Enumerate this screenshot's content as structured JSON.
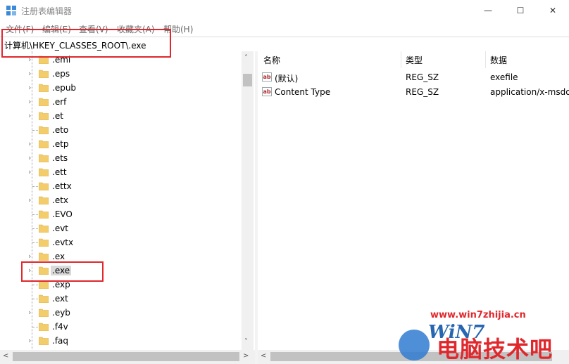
{
  "window": {
    "title": "注册表编辑器",
    "minimize_glyph": "—",
    "maximize_glyph": "☐",
    "close_glyph": "✕"
  },
  "menu": [
    "文件(F)",
    "编辑(E)",
    "查看(V)",
    "收藏夹(A)",
    "帮助(H)"
  ],
  "address": {
    "path": "计算机\\HKEY_CLASSES_ROOT\\.exe"
  },
  "tree": {
    "items": [
      {
        "label": ".eml",
        "expandable": true
      },
      {
        "label": ".eps",
        "expandable": true
      },
      {
        "label": ".epub",
        "expandable": true
      },
      {
        "label": ".erf",
        "expandable": true
      },
      {
        "label": ".et",
        "expandable": true
      },
      {
        "label": ".eto",
        "expandable": false
      },
      {
        "label": ".etp",
        "expandable": true
      },
      {
        "label": ".ets",
        "expandable": true
      },
      {
        "label": ".ett",
        "expandable": true
      },
      {
        "label": ".ettx",
        "expandable": false
      },
      {
        "label": ".etx",
        "expandable": true
      },
      {
        "label": ".EVO",
        "expandable": false
      },
      {
        "label": ".evt",
        "expandable": false
      },
      {
        "label": ".evtx",
        "expandable": false
      },
      {
        "label": ".ex",
        "expandable": true
      },
      {
        "label": ".exe",
        "expandable": true,
        "selected": true
      },
      {
        "label": ".exp",
        "expandable": false
      },
      {
        "label": ".ext",
        "expandable": false
      },
      {
        "label": ".eyb",
        "expandable": true
      },
      {
        "label": ".f4v",
        "expandable": false
      },
      {
        "label": ".faq",
        "expandable": true
      }
    ],
    "expander_glyph": "›"
  },
  "list": {
    "columns": [
      "名称",
      "类型",
      "数据"
    ],
    "rows": [
      {
        "name": "(默认)",
        "type": "REG_SZ",
        "data": "exefile",
        "icon": "ab"
      },
      {
        "name": "Content Type",
        "type": "REG_SZ",
        "data": "application/x-msdo",
        "icon": "ab"
      }
    ]
  },
  "scroll": {
    "up": "˄",
    "down": "˅",
    "left": "<",
    "right": ">"
  },
  "watermark": {
    "url": "www.win7zhijia.cn",
    "logo": "WiN7",
    "text": "电脑技术吧"
  },
  "colors": {
    "highlight": "#e0272c",
    "folder": "#f3cd6b",
    "selection": "#d9d9d9"
  }
}
